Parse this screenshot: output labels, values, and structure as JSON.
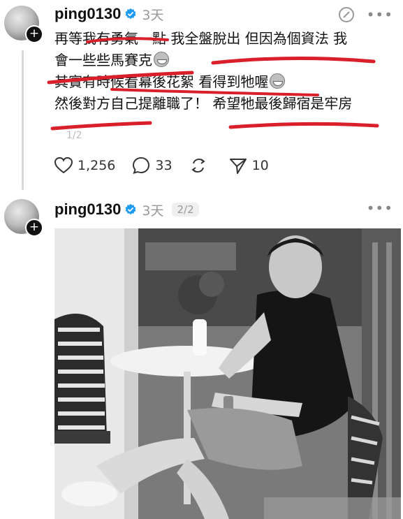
{
  "post1": {
    "username": "ping0130",
    "time": "3天",
    "lines": [
      "再等我有勇氣一點 我全盤脫出 但因為個資法 我",
      "會一些些馬賽克",
      "其實有時候看幕後花絮 看得到牠喔",
      "然後對方自己提離職了！ 希望牠最後歸宿是牢房"
    ],
    "pager": "1/2",
    "likes": "1,256",
    "comments": "33",
    "shares": "10"
  },
  "post2": {
    "username": "ping0130",
    "time": "3天",
    "page_badge": "2/2"
  },
  "icons": {
    "verified": "verified-badge-icon",
    "more": "more-options-icon",
    "edit": "edit-icon",
    "like": "heart-icon",
    "comment": "comment-icon",
    "repost": "repost-icon",
    "share": "send-icon",
    "follow": "plus-icon"
  },
  "colors": {
    "verified": "#1d9bf0",
    "scribble": "#d9202a",
    "muted": "#999999"
  }
}
